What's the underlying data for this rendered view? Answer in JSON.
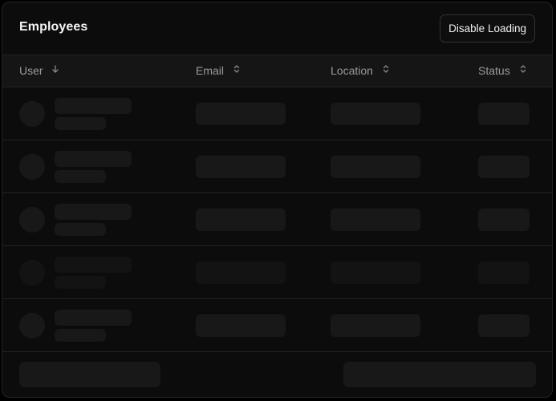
{
  "header": {
    "title": "Employees",
    "toggle_button_label": "Disable Loading"
  },
  "table": {
    "columns": [
      {
        "label": "User",
        "sort": "descending",
        "sort_icon": "arrow-down-icon"
      },
      {
        "label": "Email",
        "sort": "unsorted",
        "sort_icon": "sort-updown-icon"
      },
      {
        "label": "Location",
        "sort": "unsorted",
        "sort_icon": "sort-updown-icon"
      },
      {
        "label": "Status",
        "sort": "unsorted",
        "sort_icon": "sort-updown-icon"
      }
    ],
    "loading": true,
    "skeleton_row_count": 5
  },
  "colors": {
    "panel_background": "#0c0c0c",
    "header_row_background": "#151515",
    "skeleton": "#181818",
    "title_text": "#f4f4f4",
    "column_text": "#9a9a9a"
  }
}
